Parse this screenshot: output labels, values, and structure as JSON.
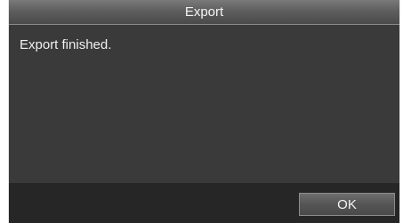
{
  "dialog": {
    "title": "Export",
    "message": "Export finished.",
    "ok_label": "OK"
  }
}
